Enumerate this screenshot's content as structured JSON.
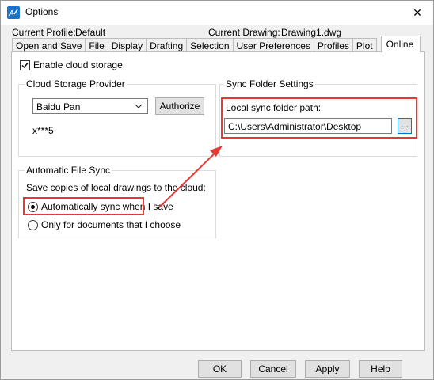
{
  "window": {
    "title": "Options",
    "close_glyph": "✕"
  },
  "profile": {
    "label": "Current Profile:",
    "value": "Default"
  },
  "drawing": {
    "label": "Current Drawing:",
    "value": "Drawing1.dwg"
  },
  "tabs": [
    {
      "label": "Open and Save"
    },
    {
      "label": "File"
    },
    {
      "label": "Display"
    },
    {
      "label": "Drafting"
    },
    {
      "label": "Selection"
    },
    {
      "label": "User Preferences"
    },
    {
      "label": "Profiles"
    },
    {
      "label": "Plot"
    },
    {
      "label": "Online"
    }
  ],
  "online": {
    "enable_cloud_label": "Enable cloud storage",
    "cloud_provider": {
      "group_title": "Cloud Storage Provider",
      "selected": "Baidu Pan",
      "authorize_label": "Authorize",
      "account": "x***5"
    },
    "sync_folder": {
      "group_title": "Sync Folder Settings",
      "path_label": "Local sync folder path:",
      "path_value": "C:\\Users\\Administrator\\Desktop",
      "browse_label": "..."
    },
    "auto_sync": {
      "group_title": "Automatic File Sync",
      "description": "Save copies of local drawings to the cloud:",
      "option_auto": "Automatically sync when I save",
      "option_choose": "Only for documents that I choose"
    }
  },
  "footer": {
    "ok": "OK",
    "cancel": "Cancel",
    "apply": "Apply",
    "help": "Help"
  },
  "colors": {
    "highlight_red": "#e53935",
    "accent_blue": "#1a73c8"
  }
}
